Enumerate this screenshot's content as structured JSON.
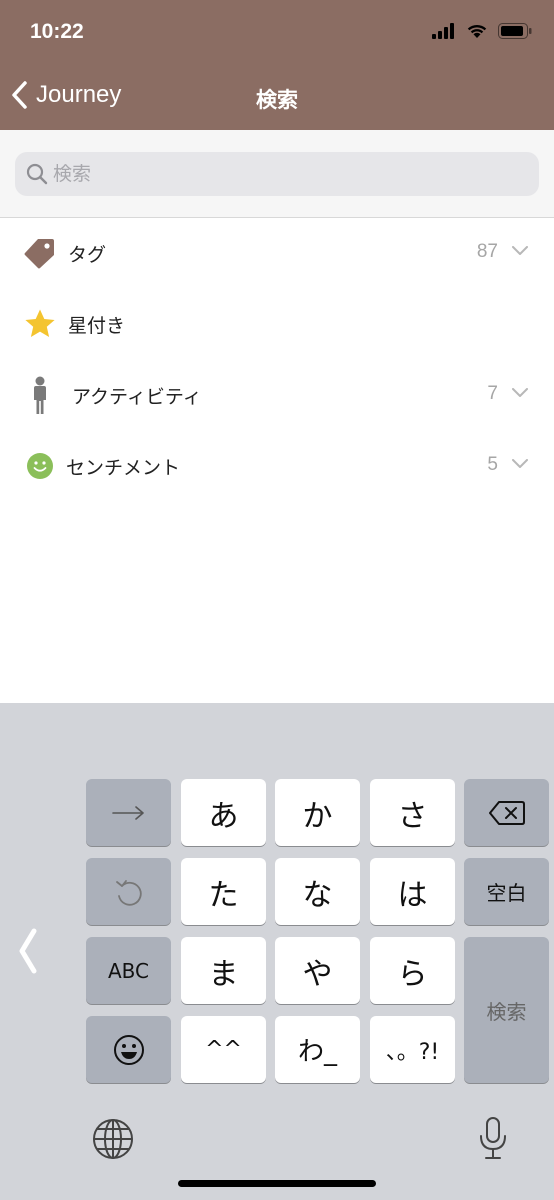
{
  "status_bar": {
    "time": "10:22"
  },
  "nav": {
    "back_label": "Journey",
    "title": "検索"
  },
  "search": {
    "placeholder": "検索",
    "value": ""
  },
  "filters": [
    {
      "label": "タグ",
      "count": "87",
      "icon": "tag-icon",
      "color": "#8b6d63"
    },
    {
      "label": "星付き",
      "count": "",
      "icon": "star-icon",
      "color": "#f4c430"
    },
    {
      "label": "アクティビティ",
      "count": "7",
      "icon": "person-icon",
      "color": "#7a7a7a"
    },
    {
      "label": "センチメント",
      "count": "5",
      "icon": "smiley-icon",
      "color": "#8bbf5a"
    }
  ],
  "keyboard": {
    "keys": {
      "a": "あ",
      "ka": "か",
      "sa": "さ",
      "ta": "た",
      "na": "な",
      "ha": "は",
      "ma": "ま",
      "ya": "や",
      "ra": "ら",
      "kaomoji": "^^",
      "wa": "わ_",
      "punct": "、。?!",
      "space": "空白",
      "abc": "ABC",
      "enter": "検索"
    }
  },
  "colors": {
    "header": "#8b6d63",
    "keyboard_bg": "#d2d4d9",
    "key_func": "#abb0ba"
  }
}
